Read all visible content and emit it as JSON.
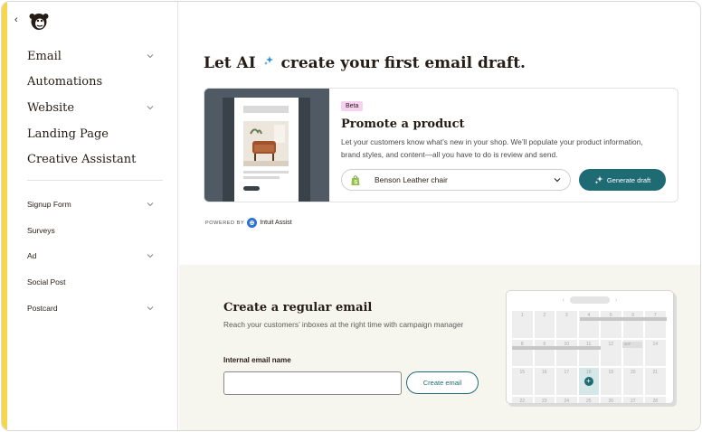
{
  "sidebar": {
    "main_items": [
      {
        "label": "Email",
        "has_chevron": true
      },
      {
        "label": "Automations",
        "has_chevron": false
      },
      {
        "label": "Website",
        "has_chevron": true
      },
      {
        "label": "Landing Page",
        "has_chevron": false
      },
      {
        "label": "Creative Assistant",
        "has_chevron": false
      }
    ],
    "sub_items": [
      {
        "label": "Signup Form",
        "has_chevron": true
      },
      {
        "label": "Surveys",
        "has_chevron": false
      },
      {
        "label": "Ad",
        "has_chevron": true
      },
      {
        "label": "Social Post",
        "has_chevron": false
      },
      {
        "label": "Postcard",
        "has_chevron": true
      }
    ],
    "accent_color": "#f4d74a"
  },
  "ai_section": {
    "title_prefix": "Let AI",
    "title_suffix": "create your first email draft.",
    "badge": "Beta",
    "card_title": "Promote a product",
    "card_description": "Let your customers know what’s new in your shop. We’ll populate your product information, brand styles, and content—all you have to do is review and send.",
    "product_selected": "Benson Leather chair",
    "generate_label": "Generate draft",
    "powered_by": "POWERED BY",
    "powered_brand": "Intuit Assist"
  },
  "regular_email": {
    "title": "Create a regular email",
    "description": "Reach your customers’ inboxes at the right time with campaign manager",
    "field_label": "Internal email name",
    "input_value": "",
    "input_placeholder": "",
    "create_label": "Create email"
  },
  "calendar": {
    "days": [
      "1",
      "2",
      "3",
      "4",
      "5",
      "6",
      "7",
      "8",
      "9",
      "10",
      "11",
      "12",
      "13",
      "14",
      "15",
      "16",
      "17",
      "18",
      "19",
      "20",
      "21",
      "22",
      "23",
      "24",
      "25",
      "26",
      "27",
      "28"
    ],
    "today": "18"
  },
  "colors": {
    "primary": "#1f6b73",
    "beta_bg": "#f6d2f0",
    "lower_bg": "#f7f6ee"
  }
}
